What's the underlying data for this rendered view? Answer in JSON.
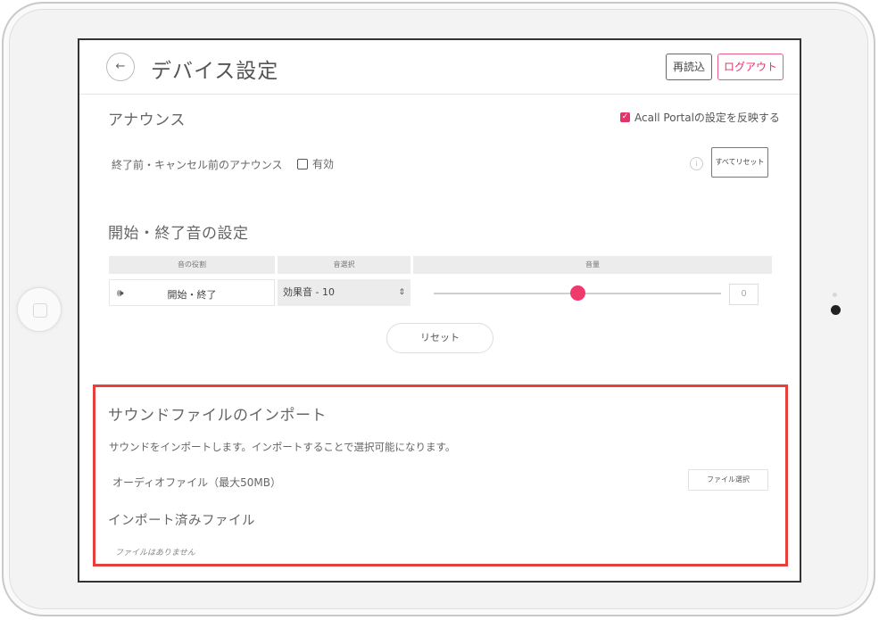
{
  "header": {
    "back_icon": "←",
    "title": "デバイス設定",
    "reload_label": "再読込",
    "logout_label": "ログアウト"
  },
  "announce": {
    "title": "アナウンス",
    "reflect_label": "Acall Portalの設定を反映する",
    "reflect_checked": true,
    "item_label": "終了前・キャンセル前のアナウンス",
    "enable_label": "有効",
    "enable_checked": false,
    "info_icon": "i",
    "reset_all_label": "すべてリセット"
  },
  "sound_settings": {
    "title": "開始・終了音の設定",
    "columns": [
      "音の役割",
      "音選択",
      "音量"
    ],
    "row": {
      "speaker_icon": "🕪",
      "role": "開始・終了",
      "selected_sound": "効果音 - 10",
      "select_arrow": "⌃⌄",
      "volume": "0"
    },
    "reset_label": "リセット"
  },
  "import": {
    "title": "サウンドファイルのインポート",
    "description": "サウンドをインポートします。インポートすることで選択可能になります。",
    "audio_file_label": "オーディオファイル（最大50MB）",
    "file_select_label": "ファイル選択",
    "imported_title": "インポート済みファイル",
    "no_files_text": "ファイルはありません"
  },
  "colors": {
    "accent": "#e2336a",
    "highlight_border": "#e5403a"
  }
}
